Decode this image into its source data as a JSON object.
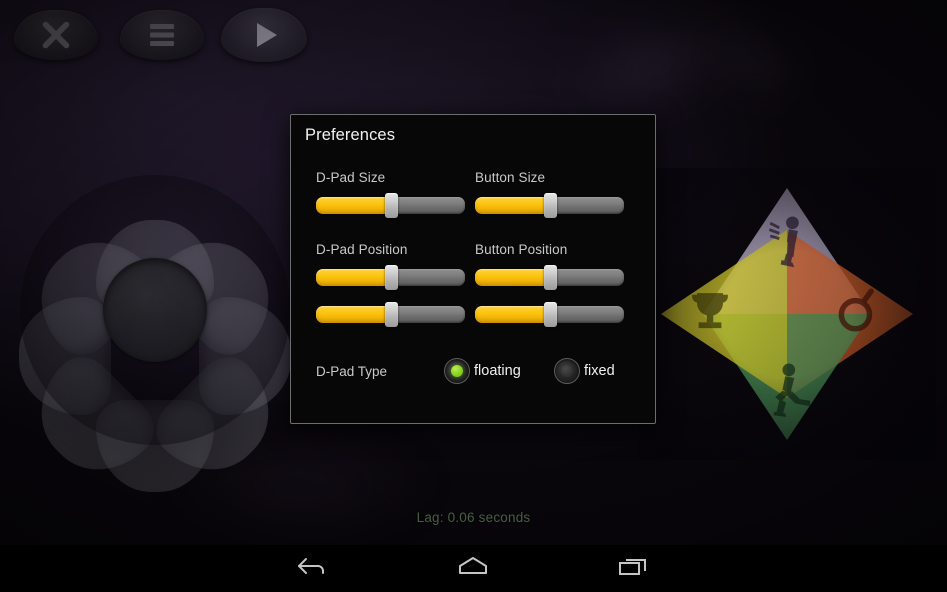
{
  "app": {
    "background_color": "#140e1c",
    "accent_yellow": "#fcc412",
    "accent_green": "#8cd520",
    "status_text_color": "#5e7a57"
  },
  "overlay_controls": [
    {
      "name": "close-button",
      "icon": "close-icon",
      "label": "Close"
    },
    {
      "name": "menu-button",
      "icon": "hamburger-menu-icon",
      "label": "Menu"
    },
    {
      "name": "play-button",
      "icon": "play-icon",
      "label": "Play"
    }
  ],
  "game_controls": {
    "dpad": {
      "name": "floating-dpad",
      "type": "floating",
      "petal_count": 8,
      "color": "#84848f"
    },
    "button_cluster": {
      "name": "action-button-cluster",
      "wedges": [
        {
          "label": "up-action",
          "icon": "running-figure-icon",
          "color": "#b9aecb"
        },
        {
          "label": "right-action",
          "icon": "ring-icon",
          "color": "#d1602a"
        },
        {
          "label": "down-action",
          "icon": "jumping-figure-icon",
          "color": "#4f9b5e"
        },
        {
          "label": "left-action",
          "icon": "trophy-icon",
          "color": "#c9c22a"
        }
      ]
    }
  },
  "status": {
    "lag_label": "Lag: 0.06 seconds"
  },
  "dialog": {
    "title": "Preferences",
    "fields": [
      {
        "label": "D-Pad Size",
        "name": "dpad-size-slider",
        "value_percent": 50
      },
      {
        "label": "Button Size",
        "name": "button-size-slider",
        "value_percent": 50
      },
      {
        "label": "D-Pad Position",
        "name": "dpad-position-x-slider",
        "value_percent": 50
      },
      {
        "label": "Button Position",
        "name": "button-position-x-slider",
        "value_percent": 50
      },
      {
        "label": "",
        "name": "dpad-position-y-slider",
        "value_percent": 50
      },
      {
        "label": "",
        "name": "button-position-y-slider",
        "value_percent": 50
      }
    ],
    "dpad_type": {
      "label": "D-Pad Type",
      "options": [
        {
          "label": "floating",
          "selected": true
        },
        {
          "label": "fixed",
          "selected": false
        }
      ]
    }
  },
  "nav_bar": {
    "buttons": [
      {
        "name": "back-button",
        "icon": "back-arrow-icon"
      },
      {
        "name": "home-button",
        "icon": "home-icon"
      },
      {
        "name": "recents-button",
        "icon": "recents-icon"
      }
    ]
  }
}
